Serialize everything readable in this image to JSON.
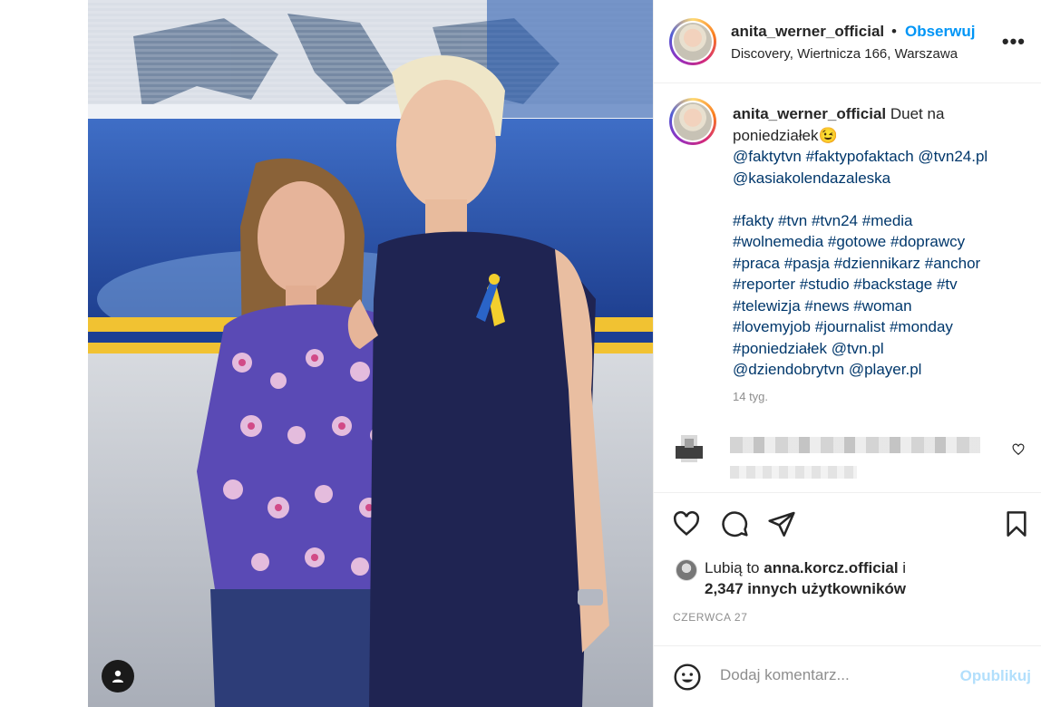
{
  "colors": {
    "brand_link": "#0095f6",
    "hashtag": "#00376b",
    "muted": "#8e8e8e",
    "publish_disabled": "#b2dffc"
  },
  "post": {
    "username": "anita_werner_official",
    "separator": "•",
    "follow_label": "Obserwuj",
    "location": "Discovery, Wiertnicza 166, Warszawa",
    "more_label": "•••",
    "caption_text": "Duet na poniedziałek",
    "caption_emoji": "😉",
    "caption_links": [
      "@faktytvn",
      "#faktypofaktach",
      "@tvn24.pl",
      "@kasiakolendazaleska",
      "#fakty",
      "#tvn",
      "#tvn24",
      "#media",
      "#wolnemedia",
      "#gotowe",
      "#doprawcy",
      "#praca",
      "#pasja",
      "#dziennikarz",
      "#anchor",
      "#reporter",
      "#studio",
      "#backstage",
      "#tv",
      "#telewizja",
      "#news",
      "#woman",
      "#lovemyjob",
      "#journalist",
      "#monday",
      "#poniedziałek",
      "@tvn.pl",
      "@dziendobrytvn",
      "@player.pl"
    ],
    "caption_time": "14 tyg.",
    "likes_prefix": "Lubią to",
    "likes_user": "anna.korcz.official",
    "likes_suffix": "i",
    "likes_count": "2,347 innych użytkowników",
    "date": "CZERWCA 27",
    "comment_placeholder": "Dodaj komentarz...",
    "publish_label": "Opublikuj"
  },
  "icons": [
    "user-tag-icon",
    "more-icon",
    "heart-icon",
    "comment-icon",
    "share-icon",
    "bookmark-icon",
    "emoji-icon",
    "like-comment-icon"
  ]
}
